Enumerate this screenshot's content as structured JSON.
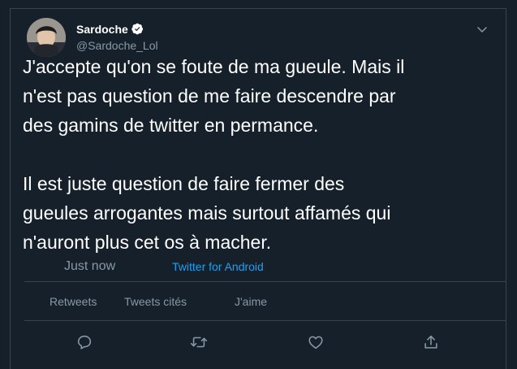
{
  "author": {
    "display_name": "Sardoche",
    "handle": "@Sardoche_Lol",
    "avatar_icon": "avatar-photo",
    "verified_icon": "verified-badge-icon"
  },
  "tweet": {
    "text": "J'accepte qu'on se foute de ma gueule. Mais il\nn'est pas question de me faire descendre par\ndes gamins de twitter en permance.\n\nIl est juste question de faire fermer des\ngueules arrogantes mais surtout affamés qui\nn'auront plus cet os à macher.",
    "timestamp": "Just now",
    "source": "Twitter for Android"
  },
  "stats": {
    "retweets_label": "Retweets",
    "quote_tweets_label": "Tweets cités",
    "likes_label": "J'aime"
  },
  "actions": {
    "reply_icon": "reply-icon",
    "retweet_icon": "retweet-icon",
    "like_icon": "like-icon",
    "share_icon": "share-icon",
    "more_icon": "chevron-down-icon"
  },
  "colors": {
    "background": "#15202b",
    "text": "#ffffff",
    "secondary_text": "#8899a6",
    "link": "#1da1f2",
    "border": "#38444d"
  }
}
